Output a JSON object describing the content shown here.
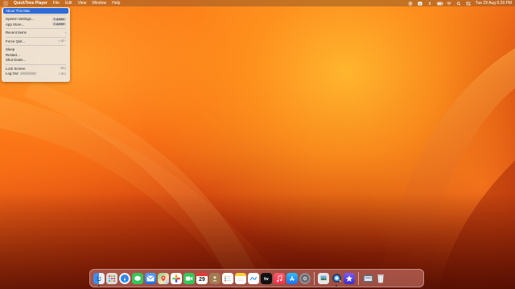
{
  "menubar": {
    "app_name": "QuickTime Player",
    "menus": [
      "File",
      "Edit",
      "View",
      "Window",
      "Help"
    ],
    "clock": "Tue 29 Aug  6:39 PM"
  },
  "apple_menu": {
    "about": "About This Mac",
    "system_settings": "System Settings...",
    "system_settings_badge": "1 update",
    "app_store": "App Store...",
    "app_store_badge": "1 update",
    "recent_items": "Recent Items",
    "force_quit": "Force Quit...",
    "force_quit_shortcut": "⌥⌘⎋",
    "sleep": "Sleep",
    "restart": "Restart...",
    "shut_down": "Shut Down...",
    "lock_screen": "Lock Screen",
    "lock_screen_shortcut": "^⌘Q",
    "log_out": "Log Out",
    "log_out_shortcut": "⇧⌘Q"
  },
  "dock": {
    "calendar_day": "29"
  },
  "colors": {
    "menu_highlight": "#2e6bd9",
    "wallpaper_orange": "#ff8f23"
  }
}
